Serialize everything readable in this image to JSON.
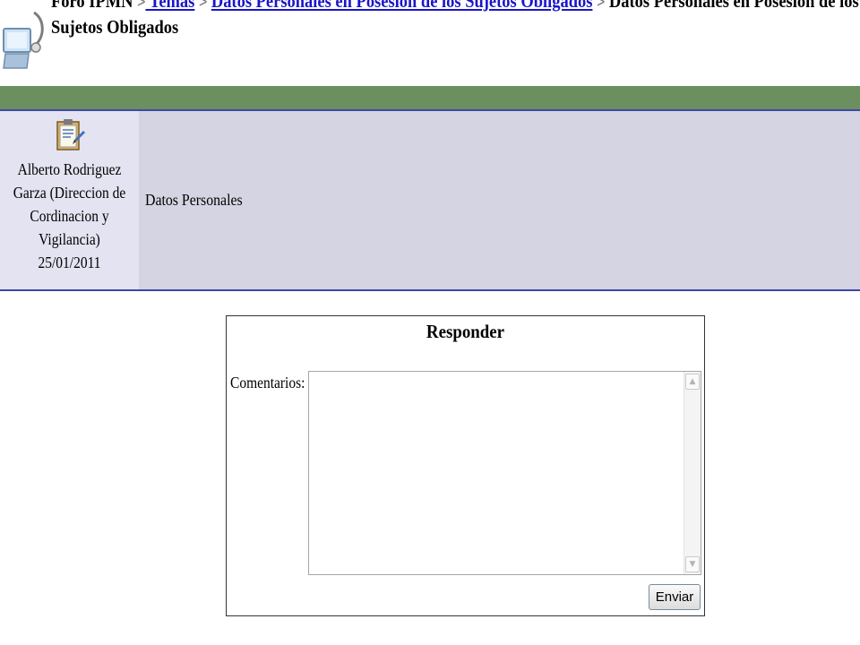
{
  "breadcrumb": {
    "root": "Foro IPMN",
    "separator": ">",
    "link1": " Temas",
    "link2": "Datos Personales en Posesion de los Sujetos Obligados",
    "current_line1": "Datos Personales en Posesion de los",
    "current_line2": "Sujetos Obligados"
  },
  "post": {
    "author_line1": "Alberto Rodriguez",
    "author_line2": "Garza (Direccion de",
    "author_line3": "Cordinacion y",
    "author_line4": "Vigilancia)",
    "date": "25/01/2011",
    "message": "Datos Personales",
    "avatar_icon": "clipboard-icon"
  },
  "reply": {
    "title": "Responder",
    "comments_label": "Comentarios:",
    "comments_value": "",
    "send_label": "Enviar"
  },
  "colors": {
    "header_bar": "#6b8f5e",
    "border": "#3d48a8",
    "author_bg": "#e3e3f1",
    "message_bg": "#d4d4e2",
    "link": "#1a16c9"
  }
}
